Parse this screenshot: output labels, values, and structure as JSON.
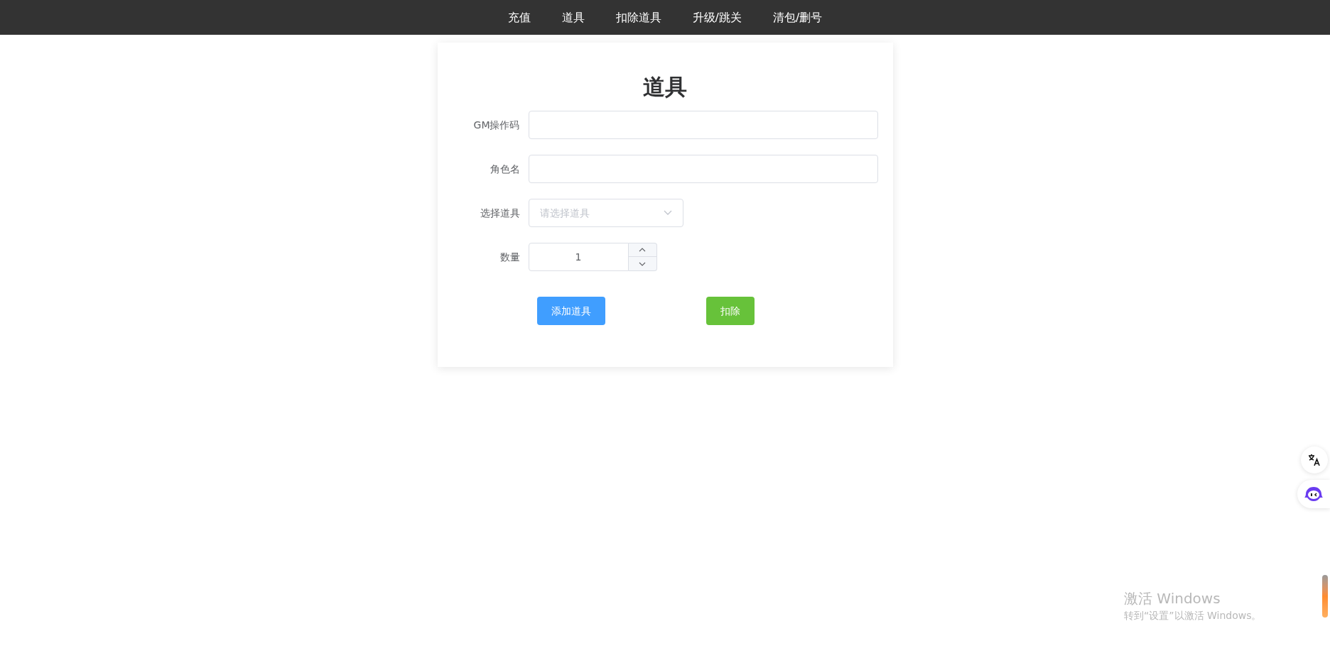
{
  "nav": {
    "items": [
      "充值",
      "道具",
      "扣除道具",
      "升级/跳关",
      "清包/删号"
    ]
  },
  "form": {
    "title": "道具",
    "fields": [
      {
        "kind": "text",
        "label": "GM操作码"
      },
      {
        "kind": "text",
        "label": "角色名"
      },
      {
        "kind": "select",
        "label": "选择道具",
        "placeholder": "请选择道具"
      },
      {
        "kind": "number",
        "label": "数量",
        "value": "1"
      }
    ],
    "buttons": [
      {
        "label": "添加道具",
        "color": "#409eff"
      },
      {
        "label": "扣除",
        "color": "#67c23a"
      }
    ]
  },
  "activation_notice": {
    "title": "激活 Windows",
    "subtitle": "转到“设置”以激活 Windows。"
  }
}
